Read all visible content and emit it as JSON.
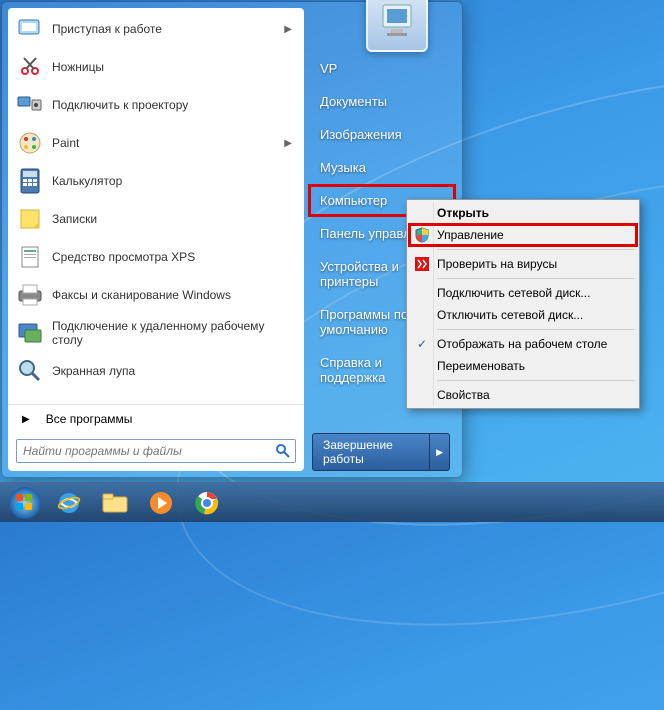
{
  "programs": [
    {
      "label": "Приступая к работе",
      "arrow": true,
      "icon": "getting-started"
    },
    {
      "label": "Ножницы",
      "arrow": false,
      "icon": "scissors"
    },
    {
      "label": "Подключить к проектору",
      "arrow": false,
      "icon": "projector"
    },
    {
      "label": "Paint",
      "arrow": true,
      "icon": "paint"
    },
    {
      "label": "Калькулятор",
      "arrow": false,
      "icon": "calculator"
    },
    {
      "label": "Записки",
      "arrow": false,
      "icon": "sticky-notes"
    },
    {
      "label": "Средство просмотра XPS",
      "arrow": false,
      "icon": "xps-viewer"
    },
    {
      "label": "Факсы и сканирование Windows",
      "arrow": false,
      "icon": "fax-scan"
    },
    {
      "label": "Подключение к удаленному рабочему столу",
      "arrow": false,
      "icon": "remote-desktop"
    },
    {
      "label": "Экранная лупа",
      "arrow": false,
      "icon": "magnifier"
    }
  ],
  "all_programs": "Все программы",
  "search": {
    "placeholder": "Найти программы и файлы"
  },
  "right_items": [
    {
      "label": "VP",
      "highlighted": false
    },
    {
      "label": "Документы",
      "highlighted": false
    },
    {
      "label": "Изображения",
      "highlighted": false
    },
    {
      "label": "Музыка",
      "highlighted": false
    },
    {
      "label": "Компьютер",
      "highlighted": true
    },
    {
      "label": "Панель управления",
      "highlighted": false
    },
    {
      "label": "Устройства и принтеры",
      "highlighted": false
    },
    {
      "label": "Программы по умолчанию",
      "highlighted": false
    },
    {
      "label": "Справка и поддержка",
      "highlighted": false
    }
  ],
  "shutdown": {
    "label": "Завершение работы"
  },
  "context_menu": [
    {
      "label": "Открыть",
      "bold": true,
      "icon": null,
      "highlighted": false
    },
    {
      "label": "Управление",
      "bold": false,
      "icon": "shield",
      "highlighted": true
    },
    {
      "sep": true
    },
    {
      "label": "Проверить на вирусы",
      "bold": false,
      "icon": "kaspersky",
      "highlighted": false
    },
    {
      "sep": true
    },
    {
      "label": "Подключить сетевой диск...",
      "bold": false,
      "icon": null,
      "highlighted": false
    },
    {
      "label": "Отключить сетевой диск...",
      "bold": false,
      "icon": null,
      "highlighted": false
    },
    {
      "sep": true
    },
    {
      "label": "Отображать на рабочем столе",
      "bold": false,
      "icon": "check",
      "highlighted": false
    },
    {
      "label": "Переименовать",
      "bold": false,
      "icon": null,
      "highlighted": false
    },
    {
      "sep": true
    },
    {
      "label": "Свойства",
      "bold": false,
      "icon": null,
      "highlighted": false
    }
  ],
  "taskbar": [
    {
      "name": "start-orb",
      "icon": "windows-orb"
    },
    {
      "name": "ie",
      "icon": "ie"
    },
    {
      "name": "explorer",
      "icon": "explorer"
    },
    {
      "name": "wmp",
      "icon": "wmp"
    },
    {
      "name": "chrome",
      "icon": "chrome"
    }
  ]
}
